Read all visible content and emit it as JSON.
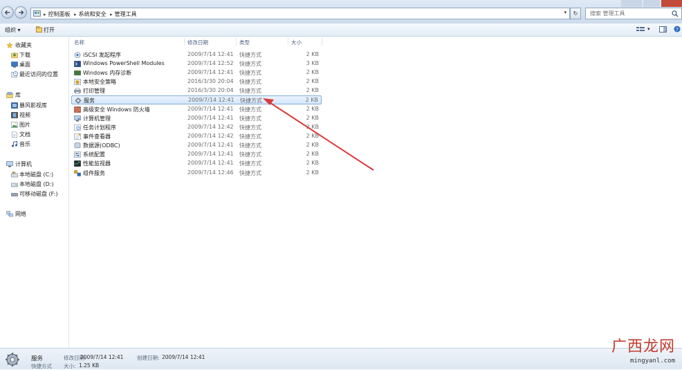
{
  "window": {
    "breadcrumbs": [
      "控制面板",
      "系统和安全",
      "管理工具"
    ],
    "search_placeholder": "搜索 管理工具"
  },
  "toolbar": {
    "organize_label": "组织 ▾",
    "open_label": "打开"
  },
  "sidebar": {
    "favorites": {
      "label": "收藏夹",
      "items": [
        "下载",
        "桌面",
        "最近访问的位置"
      ]
    },
    "libraries": {
      "label": "库",
      "items": [
        "暴风影视库",
        "视频",
        "图片",
        "文档",
        "音乐"
      ]
    },
    "computer": {
      "label": "计算机",
      "items": [
        "本地磁盘 (C:)",
        "本地磁盘 (D:)",
        "可移动磁盘 (F:)"
      ]
    },
    "network": {
      "label": "网络"
    }
  },
  "columns": {
    "name": "名称",
    "date": "修改日期",
    "type": "类型",
    "size": "大小"
  },
  "files": [
    {
      "name": "iSCSI 发起程序",
      "date": "2009/7/14 12:41",
      "type": "快捷方式",
      "size": "2 KB"
    },
    {
      "name": "Windows PowerShell Modules",
      "date": "2009/7/14 12:52",
      "type": "快捷方式",
      "size": "3 KB"
    },
    {
      "name": "Windows 内存诊断",
      "date": "2009/7/14 12:41",
      "type": "快捷方式",
      "size": "2 KB"
    },
    {
      "name": "本地安全策略",
      "date": "2016/3/30 20:04",
      "type": "快捷方式",
      "size": "2 KB"
    },
    {
      "name": "打印管理",
      "date": "2016/3/30 20:04",
      "type": "快捷方式",
      "size": "2 KB"
    },
    {
      "name": "服务",
      "date": "2009/7/14 12:41",
      "type": "快捷方式",
      "size": "2 KB"
    },
    {
      "name": "高级安全 Windows 防火墙",
      "date": "2009/7/14 12:41",
      "type": "快捷方式",
      "size": "2 KB"
    },
    {
      "name": "计算机管理",
      "date": "2009/7/14 12:41",
      "type": "快捷方式",
      "size": "2 KB"
    },
    {
      "name": "任务计划程序",
      "date": "2009/7/14 12:42",
      "type": "快捷方式",
      "size": "2 KB"
    },
    {
      "name": "事件查看器",
      "date": "2009/7/14 12:42",
      "type": "快捷方式",
      "size": "2 KB"
    },
    {
      "name": "数据源(ODBC)",
      "date": "2009/7/14 12:41",
      "type": "快捷方式",
      "size": "2 KB"
    },
    {
      "name": "系统配置",
      "date": "2009/7/14 12:41",
      "type": "快捷方式",
      "size": "2 KB"
    },
    {
      "name": "性能监视器",
      "date": "2009/7/14 12:41",
      "type": "快捷方式",
      "size": "2 KB"
    },
    {
      "name": "组件服务",
      "date": "2009/7/14 12:46",
      "type": "快捷方式",
      "size": "2 KB"
    }
  ],
  "status": {
    "name": "服务",
    "type": "快捷方式",
    "modified_label": "修改日期:",
    "modified": "2009/7/14 12:41",
    "created_label": "创建日期:",
    "created": "2009/7/14 12:41",
    "size_label": "大小:",
    "size": "1.25 KB"
  },
  "watermark": {
    "brand": "广西龙网",
    "url": "mingyanl.com"
  },
  "colors": {
    "arrow": "#d93a3a",
    "selection_border": "#84acdd"
  }
}
